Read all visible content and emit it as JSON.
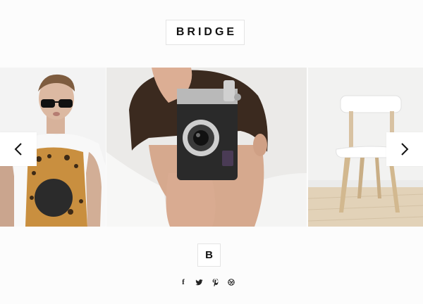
{
  "brand": {
    "logo_text": "BRIDGE",
    "mini_logo_text": "B"
  },
  "carousel": {
    "slides": [
      {
        "name": "man-with-sunglasses"
      },
      {
        "name": "man-with-camera"
      },
      {
        "name": "white-chair"
      }
    ],
    "prev_icon": "chevron-left-icon",
    "next_icon": "chevron-right-icon"
  },
  "social": {
    "icons": [
      "facebook-icon",
      "twitter-icon",
      "pinterest-icon",
      "dribbble-icon"
    ],
    "facebook_glyph": "f"
  },
  "colors": {
    "background": "#fcfcfc",
    "text": "#111111",
    "border": "#e4e4e4"
  }
}
